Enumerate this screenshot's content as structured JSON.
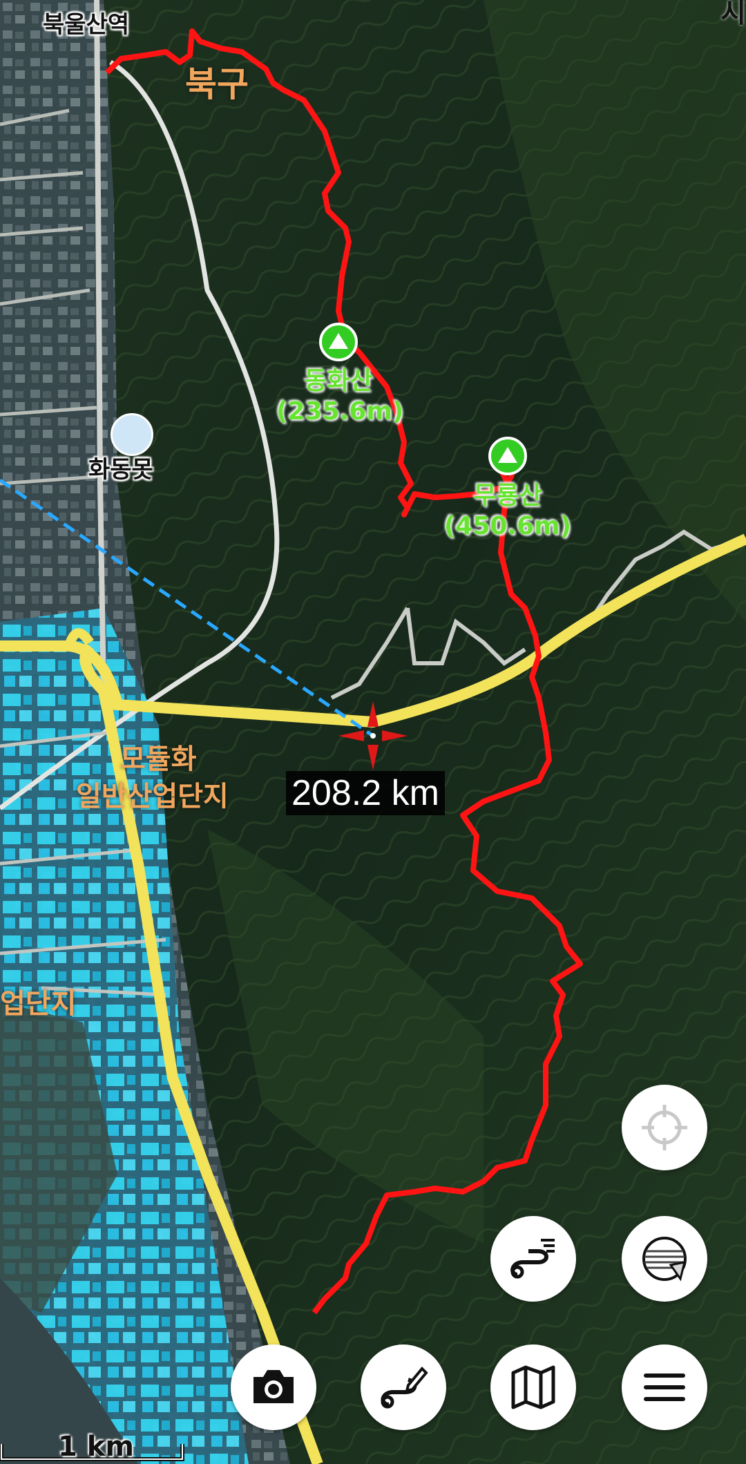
{
  "map": {
    "places": {
      "station": "북울산역",
      "district": "북구",
      "pond": "화동못",
      "industrial_complex_line1": "모듈화",
      "industrial_complex_line2": "일반산업단지",
      "industrial_left": "업단지",
      "corner_text": "시"
    },
    "peaks": [
      {
        "name": "동화산",
        "elevation": "(235.6m)"
      },
      {
        "name": "무룡산",
        "elevation": "(450.6m)"
      }
    ],
    "distance_readout": "208.2 km",
    "scale_label": "1 km",
    "colors": {
      "track": "#ff1414",
      "highway": "#f3e35a",
      "road": "#d8dcd6",
      "bearing_line": "#2aa8ff",
      "peak_marker": "#33cc22",
      "industrial": "#22c3e6"
    }
  },
  "controls": {
    "locate_icon": "crosshair-icon",
    "route_list_icon": "route-list-icon",
    "layers_icon": "layers-icon",
    "camera_icon": "camera-icon",
    "draw_route_icon": "draw-route-icon",
    "map_icon": "map-icon",
    "menu_icon": "menu-icon"
  }
}
